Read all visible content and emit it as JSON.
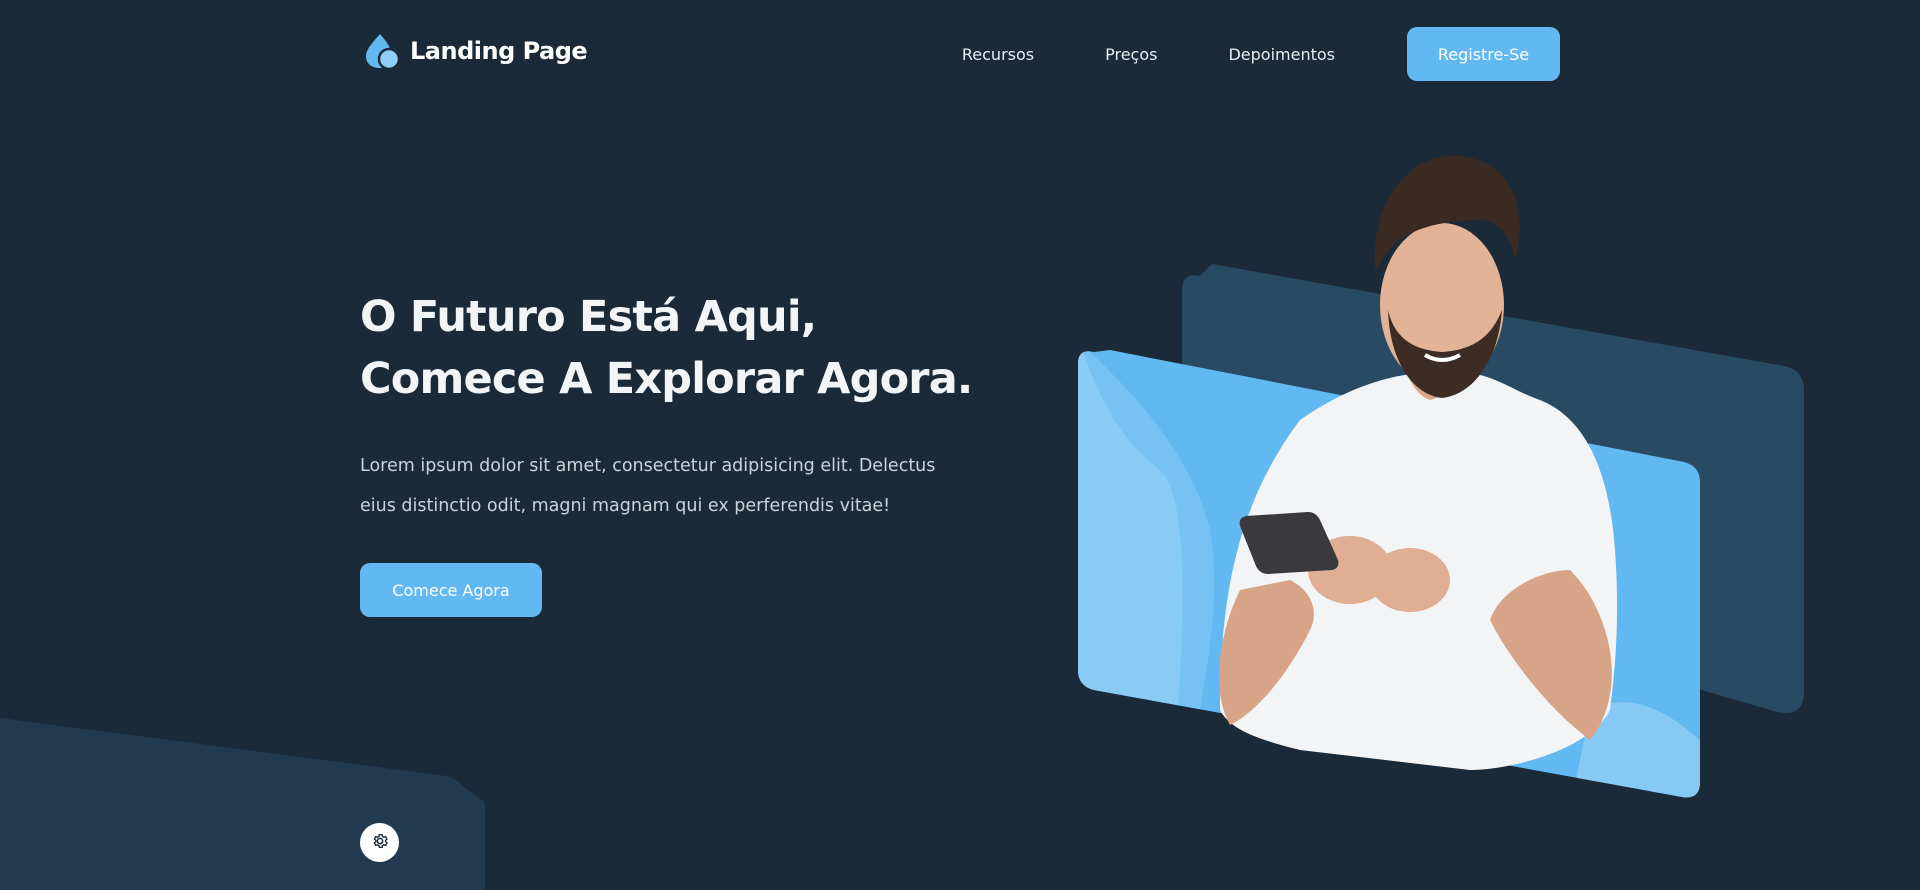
{
  "brand": {
    "name": "Landing Page",
    "logo_icon": "water-drop-icon",
    "accent": "#62b8f0",
    "background": "#1b2a38",
    "panel_dark": "#284b63"
  },
  "nav": {
    "items": [
      {
        "label": "Recursos"
      },
      {
        "label": "Preços"
      },
      {
        "label": "Depoimentos"
      }
    ],
    "register_label": "Registre-Se"
  },
  "hero": {
    "title_line1": "O Futuro Está Aqui,",
    "title_line2": "Comece A Explorar Agora.",
    "description": "Lorem ipsum dolor sit amet, consectetur adipisicing elit. Delectus eius distinctio odit, magni magnam qui ex perferendis vitae!",
    "cta_label": "Comece Agora",
    "image": "man-with-smartphone-photo"
  },
  "settings": {
    "icon": "gear-icon"
  }
}
